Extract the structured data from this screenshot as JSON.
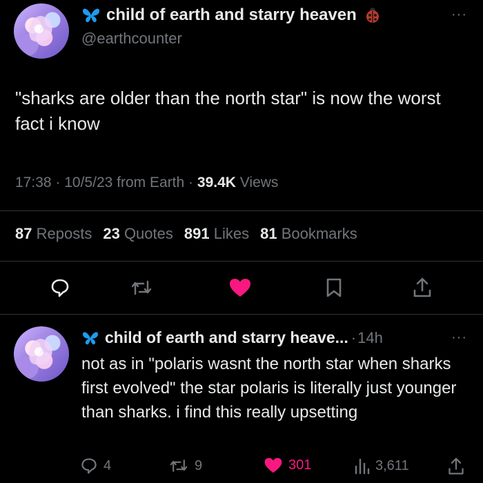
{
  "main_tweet": {
    "display_name": "child of earth and starry heaven",
    "handle": "@earthcounter",
    "more": "···",
    "text": "\"sharks are older than the north star\" is now the worst fact i know",
    "time": "17:38",
    "date": "10/5/23",
    "source": "from Earth",
    "views_count": "39.4K",
    "views_label": "Views",
    "sep": "·",
    "stats": {
      "reposts_count": "87",
      "reposts_label": "Reposts",
      "quotes_count": "23",
      "quotes_label": "Quotes",
      "likes_count": "891",
      "likes_label": "Likes",
      "bookmarks_count": "81",
      "bookmarks_label": "Bookmarks"
    }
  },
  "reply_tweet": {
    "display_name": "child of earth and starry heave...",
    "time_ago": "14h",
    "sep": "·",
    "more": "···",
    "text": "not as in \"polaris wasnt the north star when sharks first evolved\" the star polaris is literally just younger than sharks. i find this really upsetting",
    "replies": "4",
    "reposts": "9",
    "likes": "301",
    "views": "3,611"
  },
  "icons": [
    "butterfly-icon",
    "ladybug-icon",
    "reply-icon",
    "repost-icon",
    "heart-icon",
    "bookmark-icon",
    "share-icon",
    "views-icon"
  ],
  "colors": {
    "background": "#000000",
    "text": "#e7e9ea",
    "muted": "#71767b",
    "like": "#f91880",
    "butterfly": "#1d9bf0",
    "divider": "#2f3336"
  }
}
